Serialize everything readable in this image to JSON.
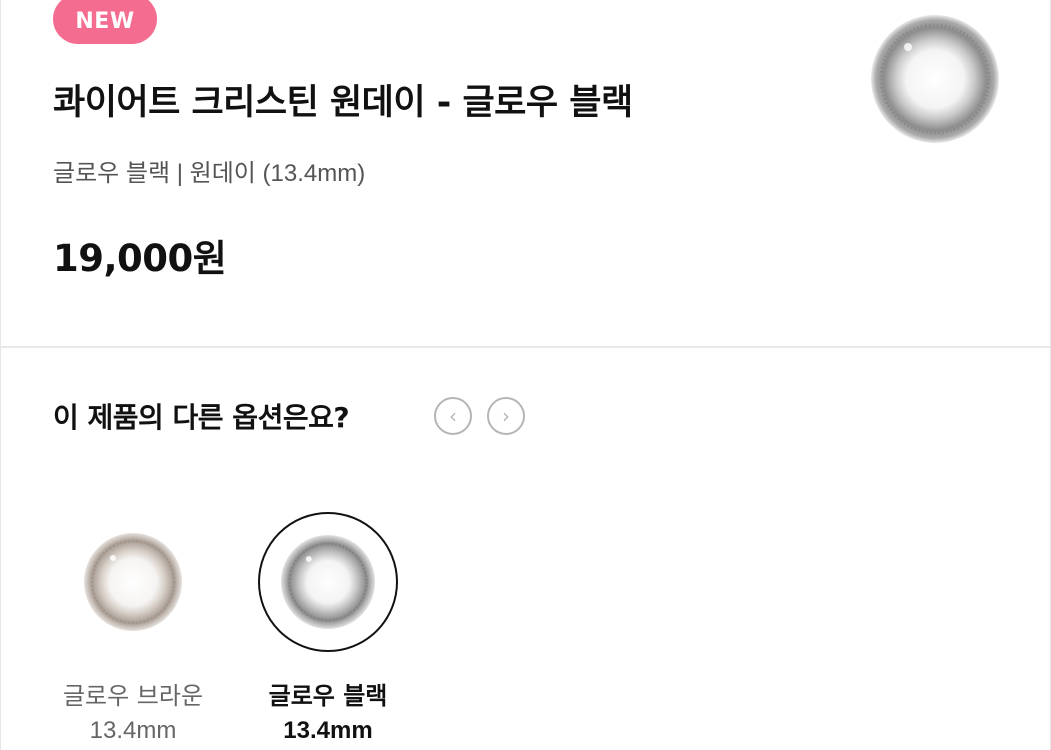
{
  "badge": {
    "label": "NEW",
    "color": "#f46c8f"
  },
  "product": {
    "title": "콰이어트 크리스틴 원데이 - 글로우 블랙",
    "subtitle": "글로우 블랙 | 원데이 (13.4mm)",
    "price": "19,000원",
    "image_icon": "lens-glow-black-image"
  },
  "options": {
    "heading": "이 제품의 다른 옵션은요?",
    "prev_icon": "‹",
    "next_icon": "›",
    "items": [
      {
        "name": "글로우 브라운",
        "size": "13.4mm",
        "selected": false
      },
      {
        "name": "글로우 블랙",
        "size": "13.4mm",
        "selected": true
      }
    ]
  }
}
